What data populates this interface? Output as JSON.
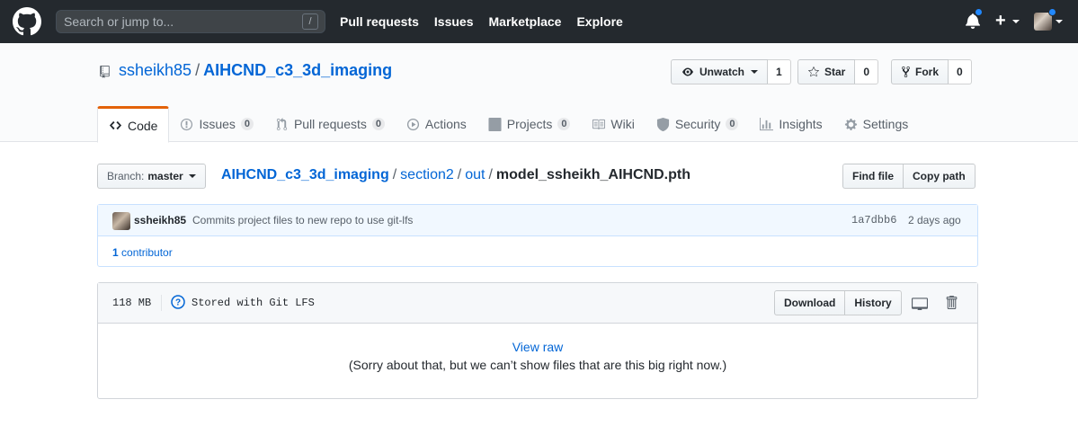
{
  "header": {
    "search_placeholder": "Search or jump to...",
    "search_key": "/",
    "nav": [
      "Pull requests",
      "Issues",
      "Marketplace",
      "Explore"
    ],
    "plus": "+"
  },
  "repo": {
    "owner": "ssheikh85",
    "separator": "/",
    "name": "AIHCND_c3_3d_imaging",
    "watch_label": "Unwatch",
    "watch_count": "1",
    "star_label": "Star",
    "star_count": "0",
    "fork_label": "Fork",
    "fork_count": "0"
  },
  "tabs": [
    {
      "label": "Code",
      "count": null
    },
    {
      "label": "Issues",
      "count": "0"
    },
    {
      "label": "Pull requests",
      "count": "0"
    },
    {
      "label": "Actions",
      "count": null
    },
    {
      "label": "Projects",
      "count": "0"
    },
    {
      "label": "Wiki",
      "count": null
    },
    {
      "label": "Security",
      "count": "0"
    },
    {
      "label": "Insights",
      "count": null
    },
    {
      "label": "Settings",
      "count": null
    }
  ],
  "branch": {
    "label": "Branch:",
    "value": "master"
  },
  "breadcrumb": {
    "repo": "AIHCND_c3_3d_imaging",
    "dir1": "section2",
    "dir2": "out",
    "file": "model_ssheikh_AIHCND.pth",
    "sep": "/"
  },
  "file_actions": {
    "find": "Find file",
    "copy": "Copy path"
  },
  "commit": {
    "author": "ssheikh85",
    "message": "Commits project files to new repo to use git-lfs",
    "sha": "1a7dbb6",
    "age": "2 days ago",
    "contributors_count": "1",
    "contributors_label": "contributor"
  },
  "file": {
    "size": "118 MB",
    "lfs_text": "Stored with Git LFS",
    "download": "Download",
    "history": "History",
    "view_raw": "View raw",
    "sorry": "(Sorry about that, but we can’t show files that are this big right now.)"
  },
  "icons": {
    "logo": "github-logo-icon",
    "bell": "bell-icon",
    "repo": "repo-icon",
    "eye": "eye-icon",
    "star": "star-icon",
    "fork": "fork-icon",
    "question": "question-icon",
    "desktop": "desktop-icon",
    "trash": "trash-icon"
  },
  "colors": {
    "accent": "#e36209",
    "link": "#0366d6",
    "header_bg": "#24292e"
  }
}
